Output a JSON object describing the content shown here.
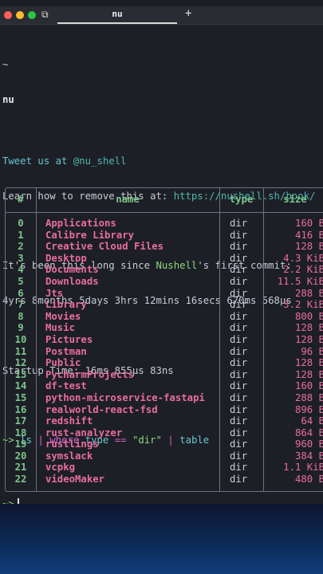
{
  "window": {
    "tab_title": "nu",
    "new_tab": "+",
    "tabs_icon": "⧉"
  },
  "terminal": {
    "tilde": "~",
    "nu": "nu",
    "tweet_prefix": "Tweet us at ",
    "tweet_handle": "@nu_shell",
    "learn_prefix": "Learn how to remove this at: ",
    "learn_url": "https://nushell.sh/book/",
    "commit_prefix": "It's been this long since ",
    "commit_name": "Nushell",
    "commit_suffix": "'s first commit:",
    "commit_age": "4yrs 8months 5days 3hrs 12mins 16secs 670ms 568µs",
    "startup": "Startup Time: 16ms 855µs 83ns",
    "prompt": "~>",
    "cmd_ls": "ls",
    "pipe1": "|",
    "cmd_where": "where",
    "cmd_type": "type",
    "cmd_eq": "==",
    "cmd_str": "\"dir\"",
    "pipe2": "|",
    "cmd_table": "table"
  },
  "table": {
    "columns": [
      "#",
      "name",
      "type",
      "size"
    ],
    "rows": [
      {
        "idx": "0",
        "name": "Applications",
        "type": "dir",
        "size": "160 B"
      },
      {
        "idx": "1",
        "name": "Calibre Library",
        "type": "dir",
        "size": "416 B"
      },
      {
        "idx": "2",
        "name": "Creative Cloud Files",
        "type": "dir",
        "size": "128 B"
      },
      {
        "idx": "3",
        "name": "Desktop",
        "type": "dir",
        "size": "4.3 KiB"
      },
      {
        "idx": "4",
        "name": "Documents",
        "type": "dir",
        "size": "2.2 KiB"
      },
      {
        "idx": "5",
        "name": "Downloads",
        "type": "dir",
        "size": "11.5 KiB"
      },
      {
        "idx": "6",
        "name": "Jts",
        "type": "dir",
        "size": "288 B"
      },
      {
        "idx": "7",
        "name": "Library",
        "type": "dir",
        "size": "3.2 KiB"
      },
      {
        "idx": "8",
        "name": "Movies",
        "type": "dir",
        "size": "800 B"
      },
      {
        "idx": "9",
        "name": "Music",
        "type": "dir",
        "size": "128 B"
      },
      {
        "idx": "10",
        "name": "Pictures",
        "type": "dir",
        "size": "128 B"
      },
      {
        "idx": "11",
        "name": "Postman",
        "type": "dir",
        "size": "96 B"
      },
      {
        "idx": "12",
        "name": "Public",
        "type": "dir",
        "size": "128 B"
      },
      {
        "idx": "13",
        "name": "PycharmProjects",
        "type": "dir",
        "size": "128 B"
      },
      {
        "idx": "14",
        "name": "df-test",
        "type": "dir",
        "size": "160 B"
      },
      {
        "idx": "15",
        "name": "python-microservice-fastapi",
        "type": "dir",
        "size": "288 B"
      },
      {
        "idx": "16",
        "name": "realworld-react-fsd",
        "type": "dir",
        "size": "896 B"
      },
      {
        "idx": "17",
        "name": "redshift",
        "type": "dir",
        "size": "64 B"
      },
      {
        "idx": "18",
        "name": "rust-analyzer",
        "type": "dir",
        "size": "864 B"
      },
      {
        "idx": "19",
        "name": "rustlings",
        "type": "dir",
        "size": "960 B"
      },
      {
        "idx": "20",
        "name": "symslack",
        "type": "dir",
        "size": "384 B"
      },
      {
        "idx": "21",
        "name": "vcpkg",
        "type": "dir",
        "size": "1.1 KiB"
      },
      {
        "idx": "22",
        "name": "videoMaker",
        "type": "dir",
        "size": "480 B"
      }
    ]
  },
  "footer": {
    "prompt": "~>"
  },
  "colors": {
    "accent_cyan": "#67c6cf",
    "accent_green": "#7cc58c",
    "accent_magenta": "#d15fcd",
    "name_pink": "#e86d9f"
  }
}
